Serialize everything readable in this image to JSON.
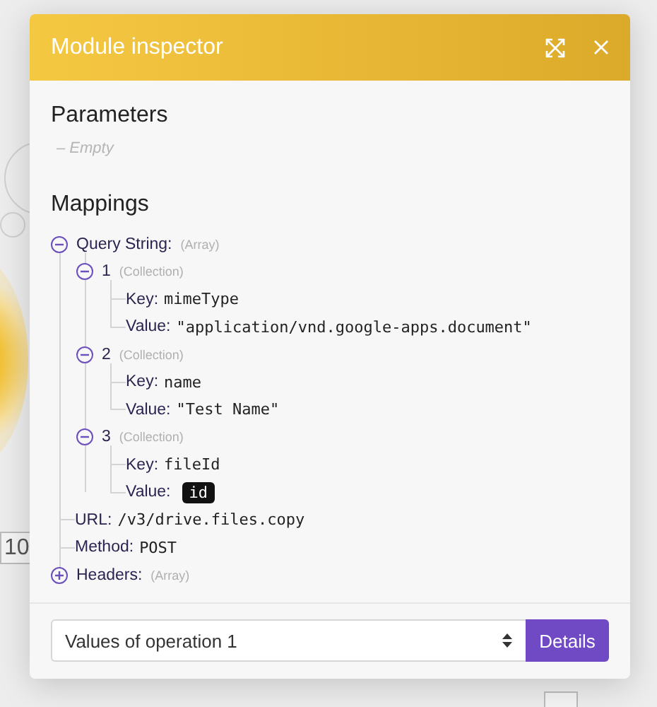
{
  "canvas": {
    "labels": [
      {
        "text": "10",
        "kind": "count"
      }
    ]
  },
  "window": {
    "title": "Module inspector"
  },
  "parameters": {
    "heading": "Parameters",
    "empty_text": "– Empty"
  },
  "mappings": {
    "heading": "Mappings",
    "items": [
      {
        "kind": "group",
        "label": "Query String:",
        "type": "(Array)",
        "expanded": true,
        "children": [
          {
            "kind": "group",
            "label": "1",
            "type": "(Collection)",
            "expanded": true,
            "children": [
              {
                "kind": "field",
                "key": "Key:",
                "value": "mimeType"
              },
              {
                "kind": "field",
                "key": "Value:",
                "value": "\"application/vnd.google-apps.document\""
              }
            ]
          },
          {
            "kind": "group",
            "label": "2",
            "type": "(Collection)",
            "expanded": true,
            "children": [
              {
                "kind": "field",
                "key": "Key:",
                "value": "name"
              },
              {
                "kind": "field",
                "key": "Value:",
                "value": "\"Test Name\""
              }
            ]
          },
          {
            "kind": "group",
            "label": "3",
            "type": "(Collection)",
            "expanded": true,
            "children": [
              {
                "kind": "field",
                "key": "Key:",
                "value": "fileId"
              },
              {
                "kind": "token",
                "key": "Value:",
                "value": "id"
              }
            ]
          }
        ]
      },
      {
        "kind": "field",
        "key": "URL:",
        "value": "/v3/drive.files.copy"
      },
      {
        "kind": "field",
        "key": "Method:",
        "value": "POST"
      },
      {
        "kind": "group",
        "label": "Headers:",
        "type": "(Array)",
        "expanded": false
      }
    ]
  },
  "footer": {
    "select_value": "Values of operation 1",
    "button": "Details"
  }
}
